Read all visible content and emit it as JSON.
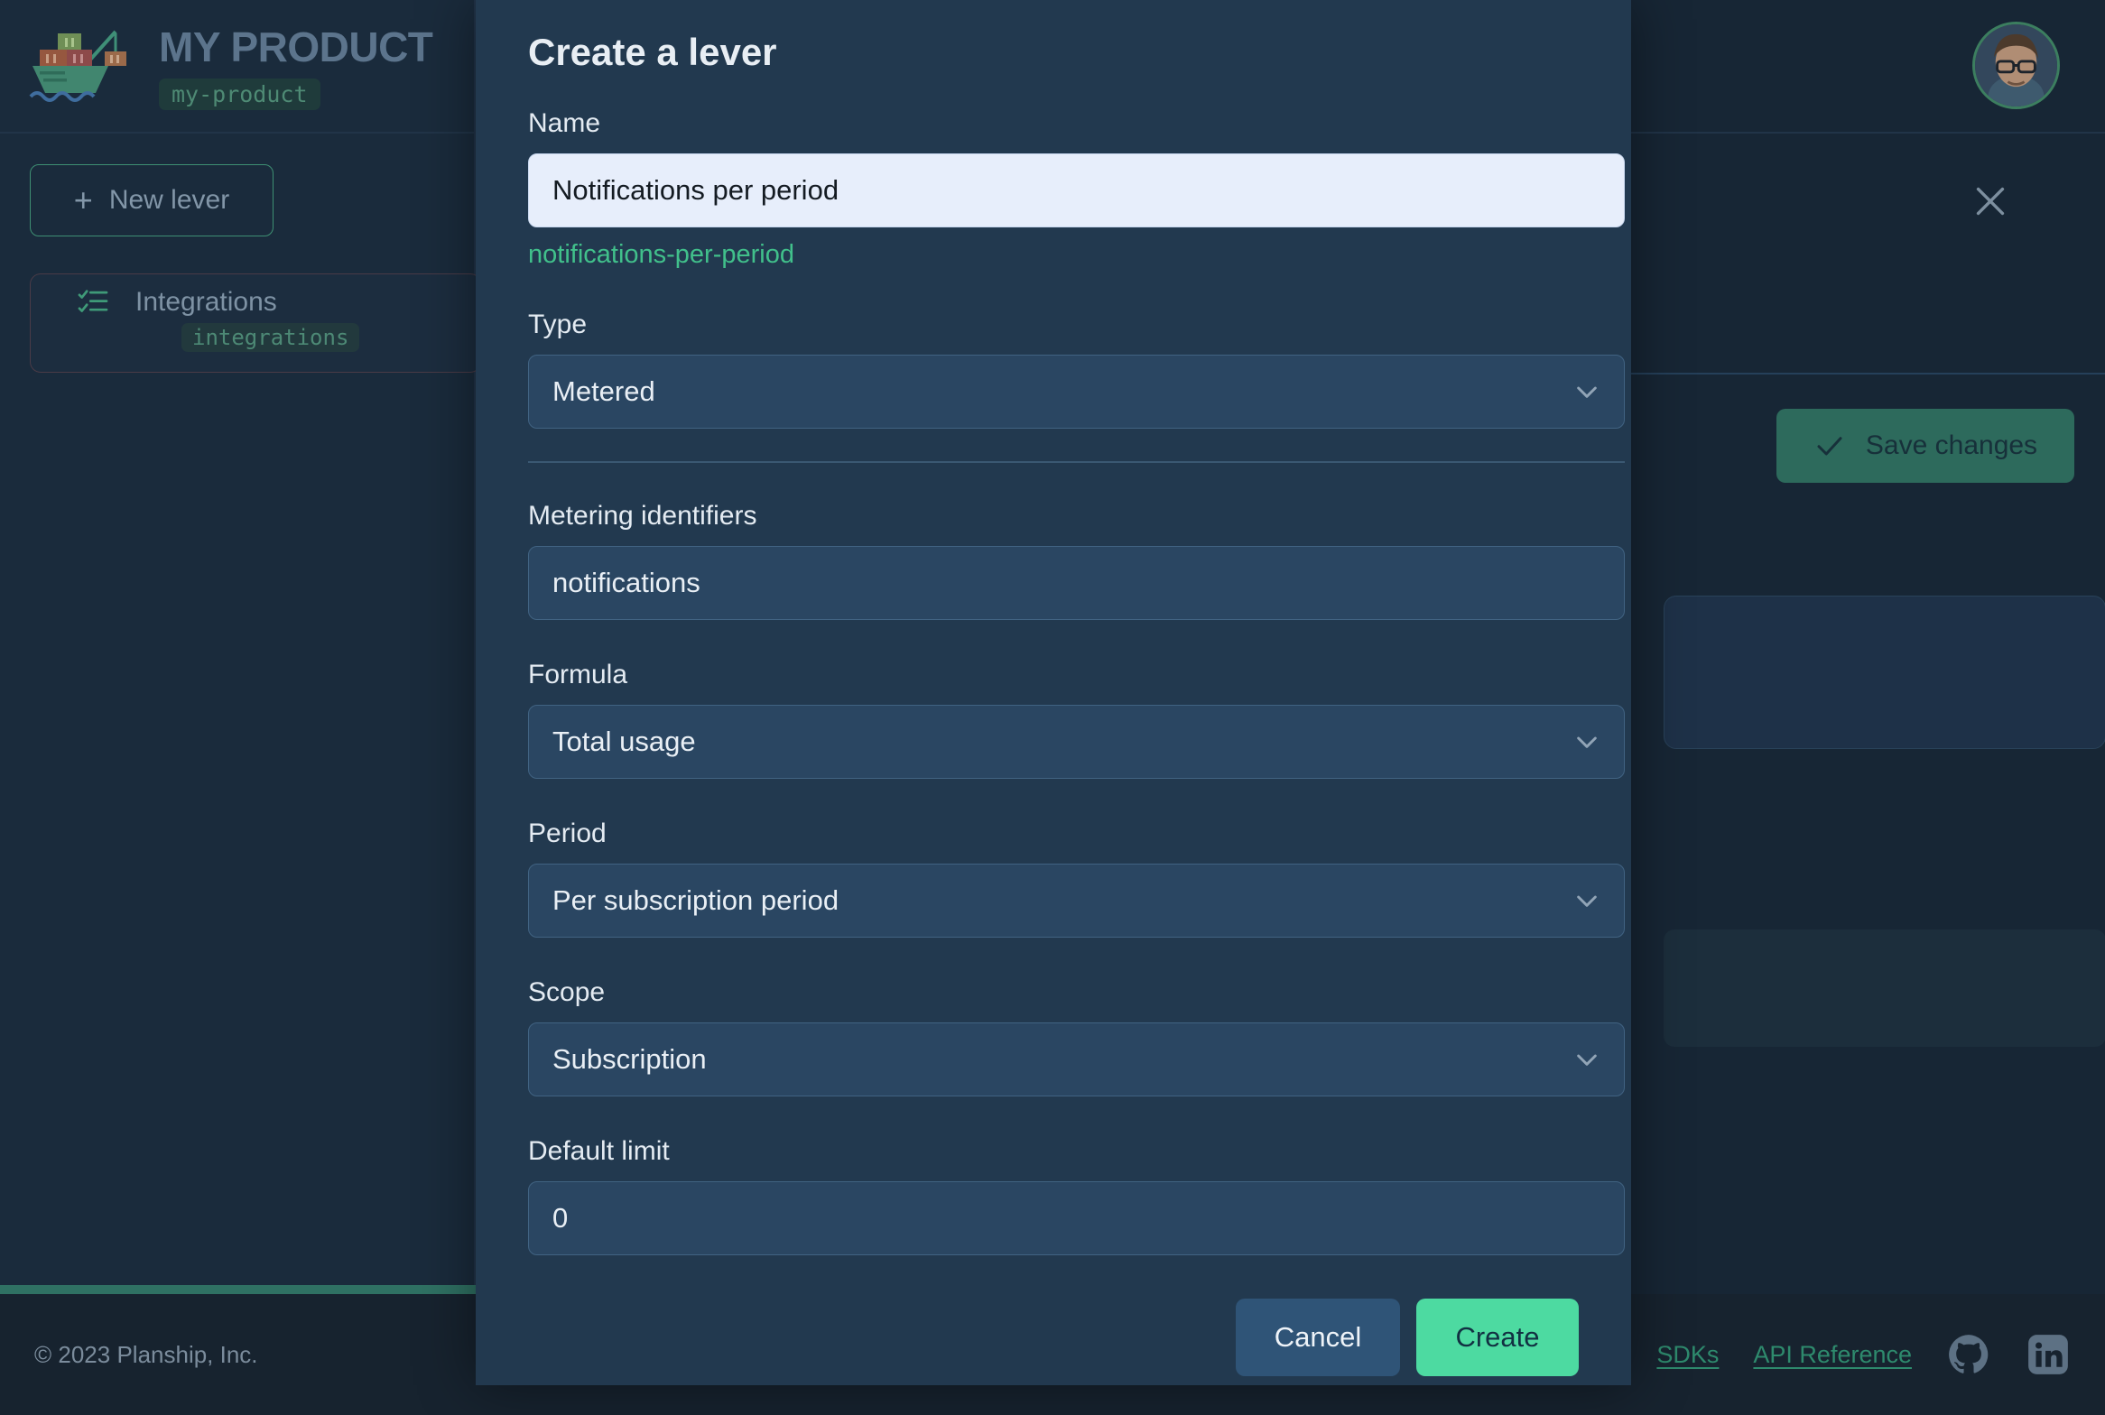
{
  "app": {
    "brand": {
      "title": "MY PRODUCT",
      "slug": "my-product",
      "logo_icon": "container-ship-icon"
    },
    "sidebar": {
      "new_lever_label": "New lever",
      "new_lever_icon": "plus-icon",
      "levers": [
        {
          "name": "Integrations",
          "slug": "integrations",
          "icon": "checklist-icon"
        }
      ]
    },
    "topbar": {
      "avatar_icon": "user-avatar",
      "close_icon": "close-icon"
    },
    "content": {
      "save_label": "Save changes",
      "save_icon": "check-icon"
    },
    "footer": {
      "copyright": "© 2023 Planship, Inc.",
      "links": [
        {
          "label": "SDKs"
        },
        {
          "label": "API Reference"
        }
      ],
      "social": [
        {
          "icon": "github-icon"
        },
        {
          "icon": "linkedin-icon"
        }
      ]
    },
    "colors": {
      "accent_green": "#4ddaa1",
      "link_green": "#2e8a6d",
      "slug_green": "#41c08b",
      "panel_bg": "#22394f",
      "app_bg": "#172635",
      "input_dark": "#2a4662",
      "cancel_blue": "#2f5477"
    }
  },
  "modal": {
    "title": "Create a lever",
    "fields": {
      "name": {
        "label": "Name",
        "value": "Notifications per period",
        "placeholder": "Name",
        "slug_hint": "notifications-per-period"
      },
      "type": {
        "label": "Type",
        "value": "Metered",
        "chevron_icon": "chevron-down-icon"
      },
      "metering_identifiers": {
        "label": "Metering identifiers",
        "value": "notifications",
        "placeholder": "Metering identifiers"
      },
      "formula": {
        "label": "Formula",
        "value": "Total usage",
        "chevron_icon": "chevron-down-icon"
      },
      "period": {
        "label": "Period",
        "value": "Per subscription period",
        "chevron_icon": "chevron-down-icon"
      },
      "scope": {
        "label": "Scope",
        "value": "Subscription",
        "chevron_icon": "chevron-down-icon"
      },
      "default_limit": {
        "label": "Default limit",
        "value": "0",
        "placeholder": "Default limit"
      }
    },
    "actions": {
      "cancel_label": "Cancel",
      "create_label": "Create"
    }
  }
}
